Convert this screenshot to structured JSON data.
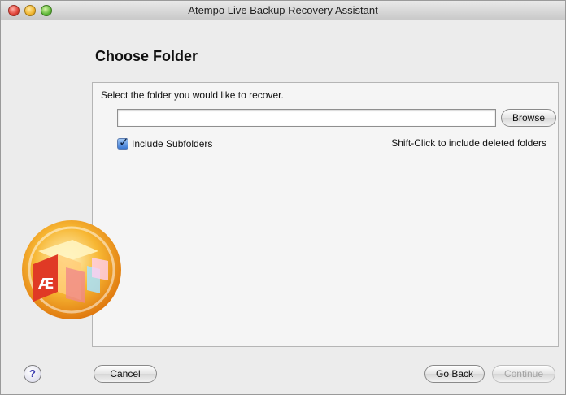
{
  "window": {
    "title": "Atempo Live Backup Recovery Assistant",
    "controls": [
      "close-icon",
      "minimize-icon",
      "zoom-icon"
    ]
  },
  "page": {
    "heading": "Choose Folder",
    "prompt": "Select the folder you would like to recover.",
    "folder_input": {
      "value": "",
      "placeholder": ""
    },
    "browse_label": "Browse",
    "include_subfolders": {
      "label": "Include Subfolders",
      "checked": true
    },
    "shift_hint": "Shift-Click to include deleted folders"
  },
  "footer": {
    "help_label": "?",
    "cancel_label": "Cancel",
    "go_back_label": "Go Back",
    "continue_label": "Continue",
    "continue_enabled": false
  },
  "logo": {
    "icon": "atempo-logo-icon"
  }
}
